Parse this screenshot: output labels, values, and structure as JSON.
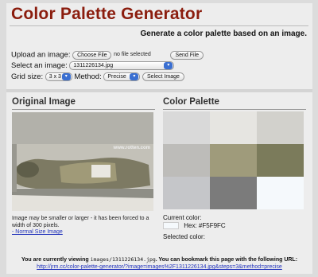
{
  "app": {
    "title": "Color Palette Generator",
    "subtitle": "Generate a color palette based on an image."
  },
  "form": {
    "upload_label": "Upload an image:",
    "choose_file": "Choose File",
    "no_file": "no file selected",
    "send_file": "Send File",
    "select_label": "Select an image:",
    "selected_image": "1311226134.jpg",
    "grid_label": "Grid size:",
    "grid_value": "3 x 3",
    "method_label": "Method:",
    "method_value": "Precise",
    "select_image_btn": "Select Image"
  },
  "original": {
    "heading": "Original Image",
    "watermark": "www.rotten.com",
    "caption": "Image may be smaller or larger - it has been forced to a width of 300 pixels.",
    "link": "- Normal Size Image"
  },
  "palette": {
    "heading": "Color Palette",
    "colors": [
      "#d9d9d9",
      "#e6e5e1",
      "#d2d1cc",
      "#bdbcb9",
      "#9f9b7b",
      "#7b7b5b",
      "#c5c6c9",
      "#7b7b7b",
      "#f5f9fc"
    ],
    "current_label": "Current color:",
    "hex_label": "Hex:",
    "hex_value": "#F5F9FC",
    "hex_color": "#f5f9fc",
    "selected_label": "Selected color:"
  },
  "footer": {
    "line1_a": "You are currently viewing",
    "line1_code": "images/1311226134.jpg",
    "line1_b": ". You can bookmark this page with the following URL:",
    "url": "http://jrm.cc/color-palette-generator/?image=images%2F1311226134.jpg&steps=3&method=precise"
  }
}
